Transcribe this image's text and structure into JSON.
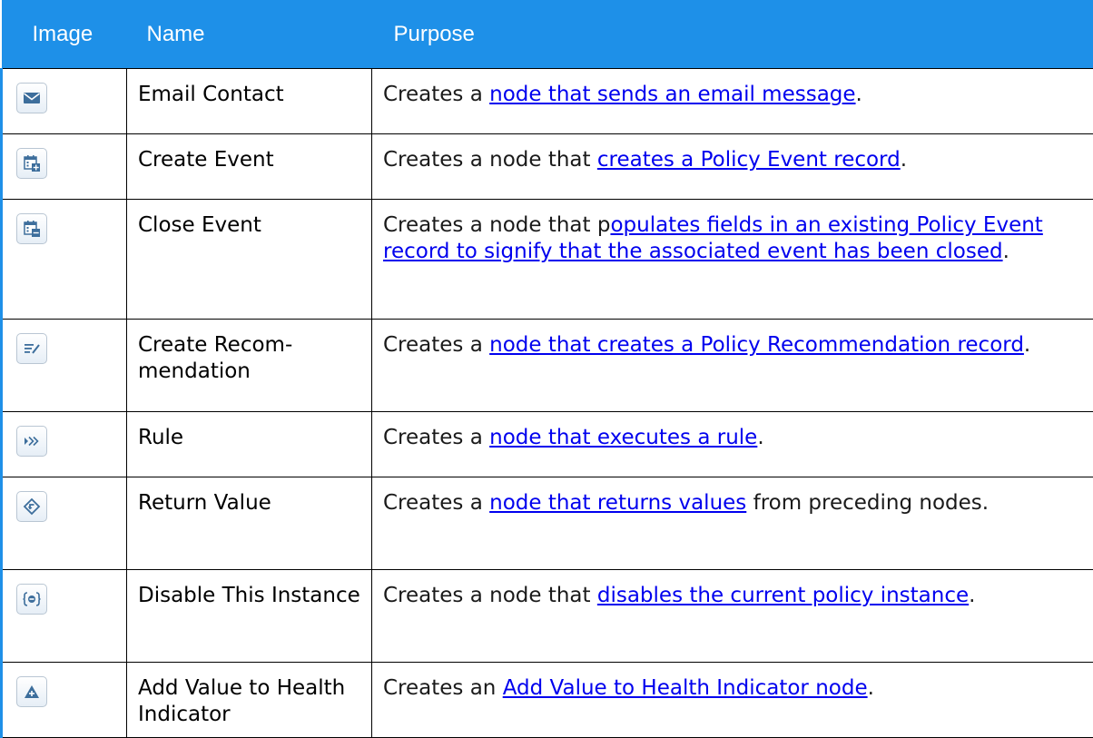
{
  "header": {
    "image": "Image",
    "name": "Name",
    "purpose": "Purpose"
  },
  "rows": [
    {
      "icon": "email-icon",
      "name": "Email Contact",
      "purpose": {
        "before": "Creates a ",
        "link": "node that sends an email message",
        "after": "."
      }
    },
    {
      "icon": "create-event-icon",
      "name": "Create Event",
      "purpose": {
        "before": "Creates a node that ",
        "link": "creates a Policy Event record",
        "after": "."
      }
    },
    {
      "icon": "close-event-icon",
      "name": "Close Event",
      "purpose": {
        "before": "Creates a node that p",
        "link": "opulates fields in an existing Policy Event record to signify that the associated event has been closed",
        "after": "."
      }
    },
    {
      "icon": "recommendation-icon",
      "name": "Create Recom-mendation",
      "purpose": {
        "before": "Creates a ",
        "link": "node that creates a Policy Recommendation record",
        "after": "."
      }
    },
    {
      "icon": "rule-icon",
      "name": "Rule",
      "purpose": {
        "before": "Creates a ",
        "link": "node that executes a rule",
        "after": "."
      }
    },
    {
      "icon": "return-value-icon",
      "name": "Return Value",
      "purpose": {
        "before": "Creates a ",
        "link": "node that returns values",
        "after": " from preceding nodes."
      }
    },
    {
      "icon": "disable-instance-icon",
      "name": "Disable This Instance",
      "purpose": {
        "before": "Creates a node that ",
        "link": "disables the current policy instance",
        "after": "."
      }
    },
    {
      "icon": "health-indicator-icon",
      "name": "Add Value to Health Indicator",
      "purpose": {
        "before": "Creates an ",
        "link": "Add Value to Health Indicator node",
        "after": "."
      }
    }
  ],
  "colors": {
    "header_bg": "#1e90e8",
    "link": "#0000ee"
  }
}
